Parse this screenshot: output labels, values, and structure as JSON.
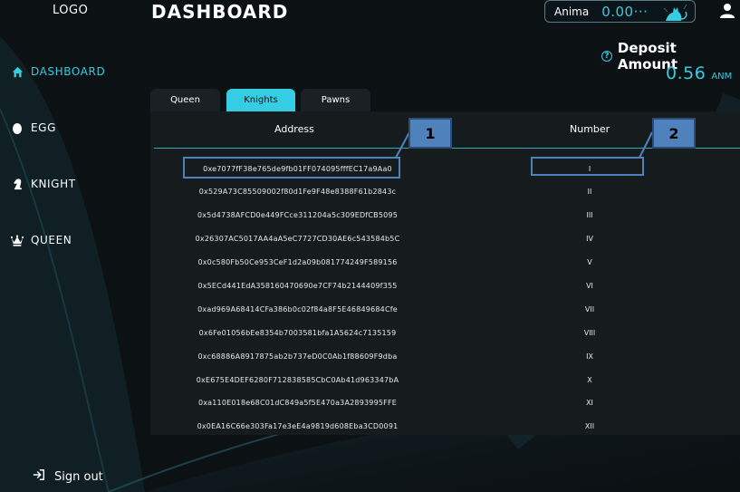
{
  "sidebar": {
    "logo": "LOGO",
    "items": [
      {
        "label": "DASHBOARD",
        "icon": "home-icon"
      },
      {
        "label": "EGG",
        "icon": "egg-icon"
      },
      {
        "label": "KNIGHT",
        "icon": "knight-icon"
      },
      {
        "label": "QUEEN",
        "icon": "queen-icon"
      }
    ],
    "signout_label": "Sign out"
  },
  "header": {
    "title": "DASHBOARD",
    "wallet": {
      "name": "Anima",
      "value": "0.00···"
    },
    "deposit_label": "Deposit Amount",
    "deposit_value": "0.56",
    "deposit_unit": "ANM"
  },
  "tabs": [
    {
      "label": "Queen",
      "active": false
    },
    {
      "label": "Knights",
      "active": true
    },
    {
      "label": "Pawns",
      "active": false
    }
  ],
  "table": {
    "columns": [
      "Address",
      "Number"
    ],
    "rows": [
      {
        "address": "0xe7077fF38e765de9fb01FF074095fffEC17a9Aa0",
        "number": "I"
      },
      {
        "address": "0x529A73C85509002f80d1Fe9F48e8388F61b2843c",
        "number": "II"
      },
      {
        "address": "0x5d4738AFCD0e449FCce311204a5c309EDfCB5095",
        "number": "III"
      },
      {
        "address": "0x26307AC5017AA4aA5eC7727CD30AE6c543584b5C",
        "number": "IV"
      },
      {
        "address": "0x0c580Fb50Ce953CeF1d2a09b081774249F589156",
        "number": "V"
      },
      {
        "address": "0x5ECd441EdA358160470690e7CF74b2144409f355",
        "number": "VI"
      },
      {
        "address": "0xad969A68414CFa386b0c02f84a8F5E46849684Cfe",
        "number": "VII"
      },
      {
        "address": "0x6Fe01056bEe8354b7003581bfa1A5624c7135159",
        "number": "VIII"
      },
      {
        "address": "0xc68886A8917875ab2b737eD0C0Ab1f88609F9dba",
        "number": "IX"
      },
      {
        "address": "0xE675E4DEF6280F712838585CbC0Ab41d963347bA",
        "number": "X"
      },
      {
        "address": "0xa110E018e68C01dC849a5f5E470a3A2893995FFE",
        "number": "XI"
      },
      {
        "address": "0x0EA16C66e303Fa17e3eE4a9819d608Eba3CD0091",
        "number": "XII"
      }
    ]
  },
  "callouts": [
    "1",
    "2"
  ],
  "colors": {
    "accent": "#34cde3",
    "background": "#0c1114",
    "panel": "#161b1e",
    "callout": "#4f81bd"
  }
}
